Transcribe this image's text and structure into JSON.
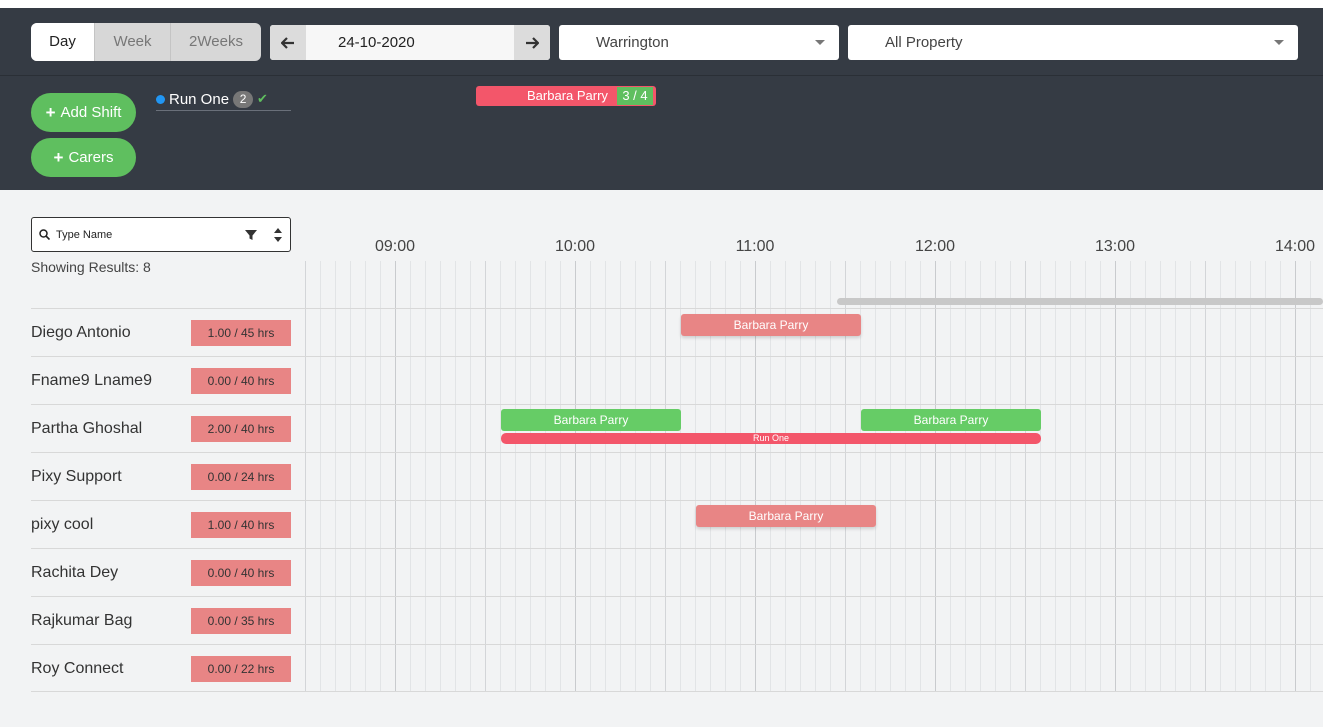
{
  "view_tabs": [
    {
      "label": "Day",
      "active": true
    },
    {
      "label": "Week",
      "active": false
    },
    {
      "label": "2Weeks",
      "active": false
    }
  ],
  "date": "24-10-2020",
  "location_select": "Warrington",
  "property_select": "All Property",
  "buttons": {
    "add_shift": "Add Shift",
    "carers": "Carers"
  },
  "run": {
    "label": "Run One",
    "count": "2"
  },
  "top_shift": {
    "label": "Barbara Parry",
    "ratio": "3 / 4"
  },
  "search": {
    "placeholder": "Type Name"
  },
  "results_text": "Showing Results: 8",
  "hours": [
    "09:00",
    "10:00",
    "11:00",
    "12:00",
    "13:00",
    "14:00"
  ],
  "carers": [
    {
      "name": "Diego Antonio",
      "hours": "1.00 / 45 hrs"
    },
    {
      "name": "Fname9 Lname9",
      "hours": "0.00 / 40 hrs"
    },
    {
      "name": "Partha Ghoshal",
      "hours": "2.00 / 40 hrs"
    },
    {
      "name": "Pixy Support",
      "hours": "0.00 / 24 hrs"
    },
    {
      "name": "pixy cool",
      "hours": "1.00 / 40 hrs"
    },
    {
      "name": "Rachita Dey",
      "hours": "0.00 / 40 hrs"
    },
    {
      "name": "Rajkumar Bag",
      "hours": "0.00 / 35 hrs"
    },
    {
      "name": "Roy Connect",
      "hours": "0.00 / 22 hrs"
    }
  ],
  "shifts": {
    "row0": "Barbara Parry",
    "row2a": "Barbara Parry",
    "row2b": "Barbara Parry",
    "row2_run": "Run One",
    "row4": "Barbara Parry"
  },
  "colors": {
    "header_bg": "#353b44",
    "green": "#5fbf5f",
    "red": "#f3566a",
    "pink": "#e88585"
  }
}
